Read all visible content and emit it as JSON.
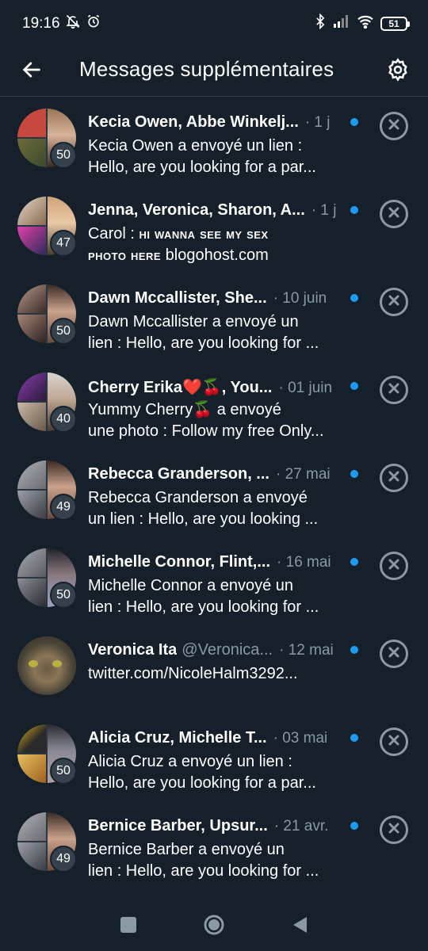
{
  "status": {
    "time": "19:16",
    "battery": "51"
  },
  "header": {
    "title": "Messages supplémentaires",
    "back_icon": "arrow-left-icon",
    "settings_icon": "gear-icon"
  },
  "colors": {
    "background": "#15202b",
    "accent": "#1d9bf0",
    "muted": "#8899a6"
  },
  "conversations": [
    {
      "name": "Kecia Owen, Abbe Winkelj...",
      "handle": "",
      "time": "· 1 j",
      "preview_1": "Kecia Owen a envoyé un lien :",
      "preview_2": "Hello, are you looking for a par...",
      "count": "50",
      "unread": true
    },
    {
      "name": "Jenna, Veronica, Sharon, A...",
      "handle": "",
      "time": "· 1 j",
      "preview_1": "Carol : ",
      "preview_1_caps": "hi wanna see my sex",
      "preview_2_caps": "photo here",
      "preview_2": " blogohost.com",
      "count": "47",
      "unread": true
    },
    {
      "name": "Dawn Mccallister, She...",
      "handle": "",
      "time": "· 10 juin",
      "preview_1": "Dawn Mccallister a envoyé un",
      "preview_2": "lien : Hello, are you looking for ...",
      "count": "50",
      "unread": true
    },
    {
      "name": "Cherry Erika❤️🍒, You...",
      "handle": "",
      "time": "· 01 juin",
      "preview_1": "Yummy Cherry🍒 a envoyé",
      "preview_2": "une photo : Follow my free Only...",
      "count": "40",
      "unread": true
    },
    {
      "name": "Rebecca Granderson, ...",
      "handle": "",
      "time": "· 27 mai",
      "preview_1": "Rebecca Granderson a envoyé",
      "preview_2": "un lien : Hello, are you looking ...",
      "count": "49",
      "unread": true
    },
    {
      "name": "Michelle Connor, Flint,...",
      "handle": "",
      "time": "· 16 mai",
      "preview_1": "Michelle Connor a envoyé un",
      "preview_2": "lien : Hello, are you looking for ...",
      "count": "50",
      "unread": true
    },
    {
      "name": "Veronica Ita",
      "handle": "@Veronica...",
      "time": "· 12 mai",
      "preview_1": "twitter.com/NicoleHalm3292...",
      "preview_2": "",
      "count": "",
      "unread": true
    },
    {
      "name": "Alicia Cruz, Michelle T...",
      "handle": "",
      "time": "· 03 mai",
      "preview_1": "Alicia Cruz a envoyé un lien :",
      "preview_2": "Hello, are you looking for a par...",
      "count": "50",
      "unread": true
    },
    {
      "name": "Bernice Barber, Upsur...",
      "handle": "",
      "time": "· 21 avr.",
      "preview_1": "Bernice Barber a envoyé un",
      "preview_2": "lien : Hello, are you looking for ...",
      "count": "49",
      "unread": true
    }
  ],
  "navbar": {
    "recents_icon": "square-icon",
    "home_icon": "circle-home-icon",
    "back_icon": "triangle-back-icon"
  }
}
